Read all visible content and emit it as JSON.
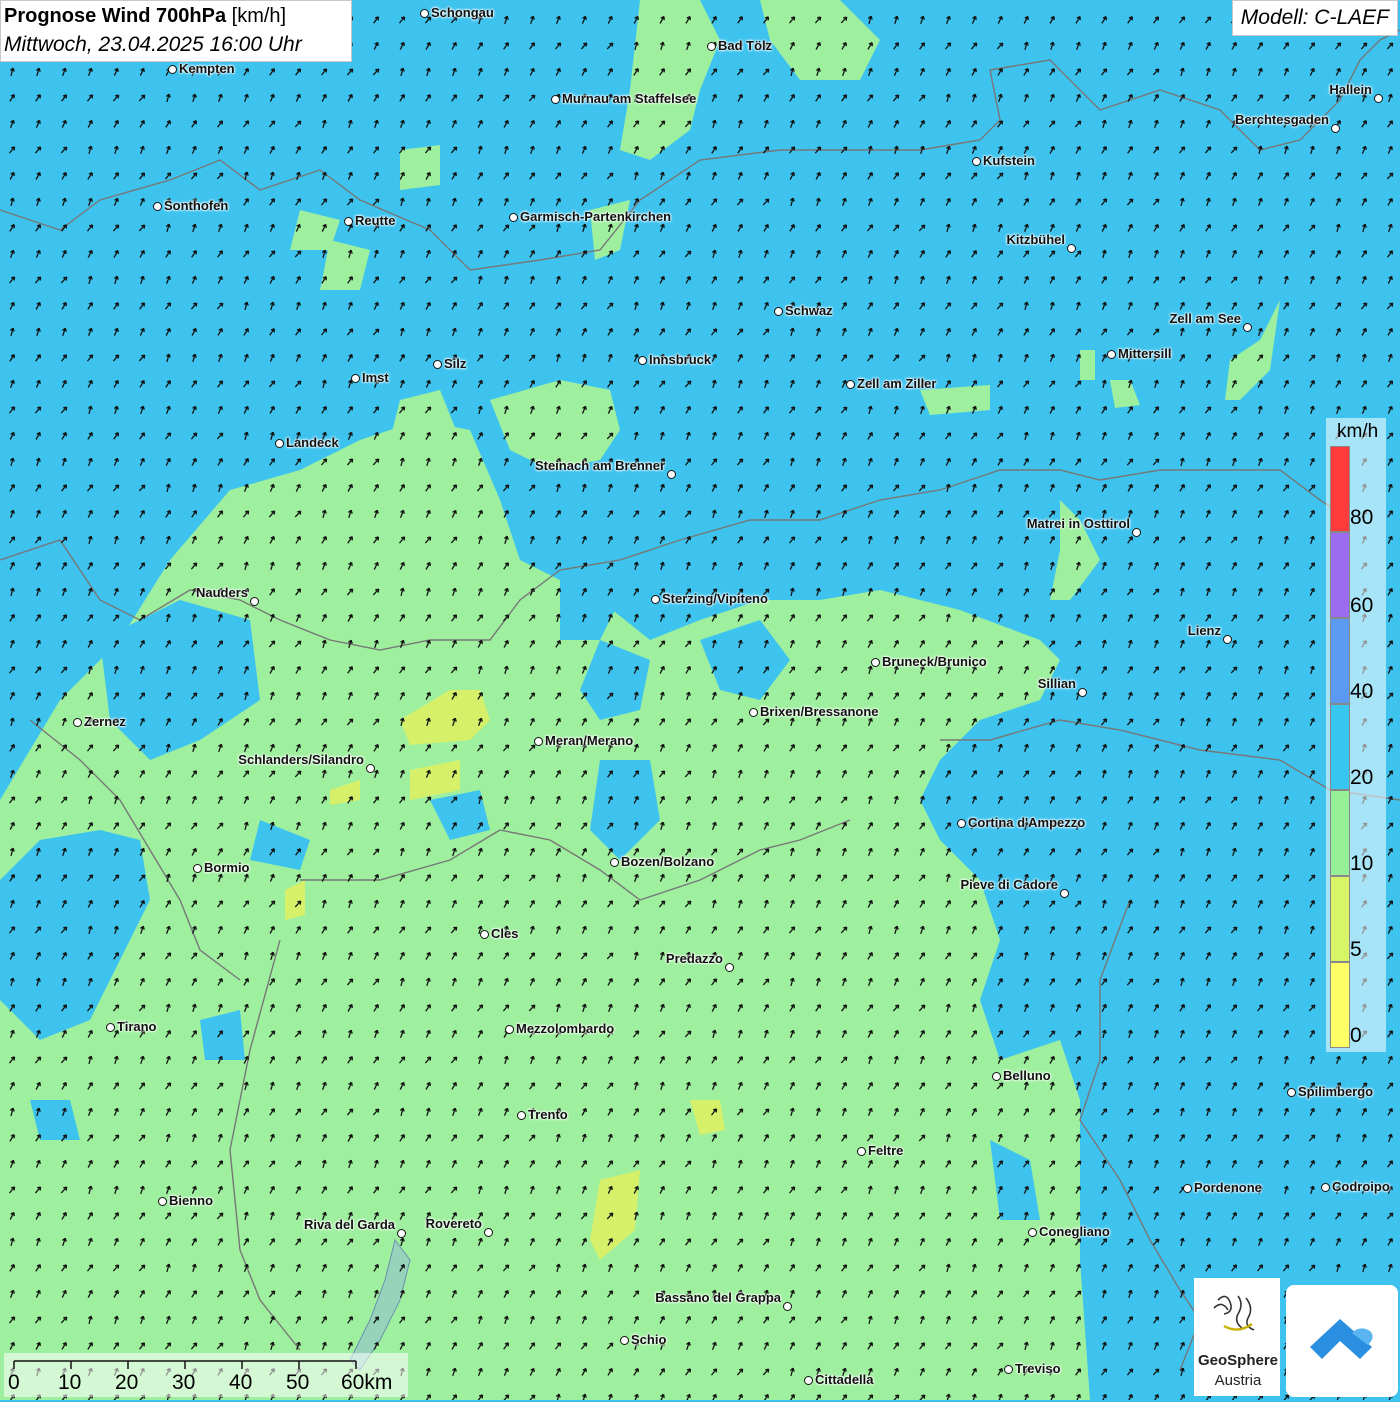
{
  "title": {
    "main": "Prognose Wind 700hPa",
    "unit": "[km/h]",
    "date": "Mittwoch, 23.04.2025 16:00 Uhr"
  },
  "model": "Modell: C-LAEF",
  "legend": {
    "unit": "km/h",
    "labels": [
      "80",
      "60",
      "40",
      "20",
      "10",
      "5",
      "0"
    ],
    "colors": [
      "#ff3b3b",
      "#9b6cf2",
      "#5a9af2",
      "#36c6f0",
      "#96f096",
      "#d8f568",
      "#ffff66"
    ]
  },
  "scale_bar": {
    "labels": [
      "0",
      "10",
      "20",
      "30",
      "40",
      "50",
      "60km"
    ]
  },
  "logo": {
    "line1": "GeoSphere",
    "line2": "Austria"
  },
  "cities": [
    "Schongau",
    "Bad Tölz",
    "Kempten",
    "Murnau am Staffelsee",
    "Hallein",
    "Berchtesgaden",
    "Kufstein",
    "Sonthofen",
    "Reutte",
    "Garmisch-Partenkirchen",
    "Kitzbühel",
    "Schwaz",
    "Zell am See",
    "Mittersill",
    "Imst",
    "Silz",
    "Innsbruck",
    "Zell am Ziller",
    "Landeck",
    "Steinach am Brenner",
    "Matrei in Osttirol",
    "Nauders",
    "Sterzing/Vipiteno",
    "Lienz",
    "Bruneck/Brunico",
    "Sillian",
    "Zernez",
    "Brixen/Bressanone",
    "Meran/Merano",
    "Schlanders/Silandro",
    "Cortina d'Ampezzo",
    "Bozen/Bolzano",
    "Bormio",
    "Pieve di Cadore",
    "Cles",
    "Predazzo",
    "Tirano",
    "Mezzolombardo",
    "Belluno",
    "Spilimbergo",
    "Trento",
    "Feltre",
    "Pordenone",
    "Codroipo",
    "Bienno",
    "Riva del Garda",
    "Rovereto",
    "Conegliano",
    "Bassano del Grappa",
    "Schio",
    "Treviso",
    "Cittadella"
  ],
  "colors": {
    "blue_band": "#3ec3ef",
    "green_band": "#9ef09e",
    "yellow_band": "#d6f06a",
    "border": "#777777",
    "arrow": "#111111"
  }
}
